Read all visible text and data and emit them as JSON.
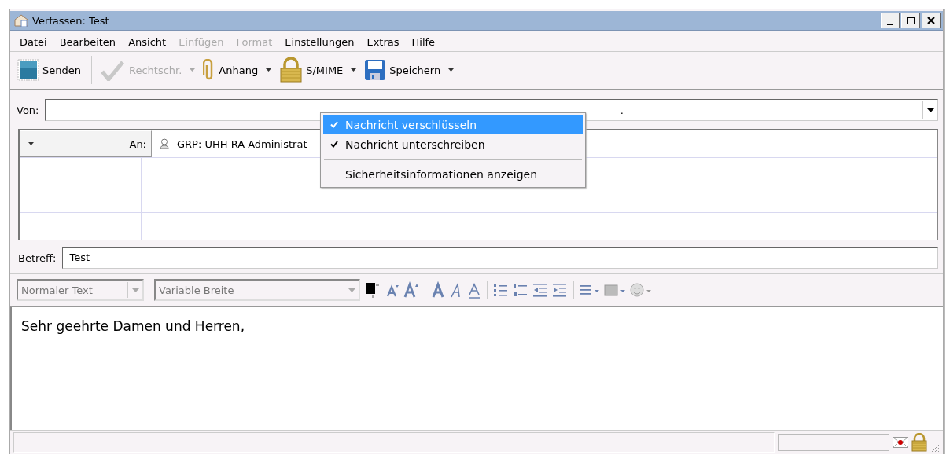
{
  "window": {
    "title": "Verfassen: Test"
  },
  "menu_bar": [
    {
      "label": "Datei",
      "disabled": false
    },
    {
      "label": "Bearbeiten",
      "disabled": false
    },
    {
      "label": "Ansicht",
      "disabled": false
    },
    {
      "label": "Einfügen",
      "disabled": true
    },
    {
      "label": "Format",
      "disabled": true
    },
    {
      "label": "Einstellungen",
      "disabled": false
    },
    {
      "label": "Extras",
      "disabled": false
    },
    {
      "label": "Hilfe",
      "disabled": false
    }
  ],
  "toolbar": [
    {
      "kind": "send",
      "label": "Senden",
      "disabled": false,
      "dropdown": false
    },
    {
      "kind": "spell",
      "label": "Rechtschr.",
      "disabled": true,
      "dropdown": true
    },
    {
      "kind": "attach",
      "label": "Anhang",
      "disabled": false,
      "dropdown": true
    },
    {
      "kind": "lock",
      "label": "S/MIME",
      "disabled": false,
      "dropdown": true
    },
    {
      "kind": "save",
      "label": "Speichern",
      "disabled": false,
      "dropdown": true
    }
  ],
  "smime_menu": [
    {
      "kind": "check",
      "label": "Nachricht verschlüsseln",
      "checked": true,
      "selected": true
    },
    {
      "kind": "check",
      "label": "Nachricht unterschreiben",
      "checked": true,
      "selected": false
    },
    {
      "kind": "separator"
    },
    {
      "kind": "item",
      "label": "Sicherheitsinformationen anzeigen",
      "selected": false
    }
  ],
  "from": {
    "label": "Von:",
    "value": "."
  },
  "recipients": [
    {
      "type": "An:",
      "address": "GRP: UHH RA Administrat"
    }
  ],
  "subject": {
    "label": "Betreff:",
    "value": "Test"
  },
  "format_bar": {
    "paragraph": "Normaler Text",
    "font": "Variable Breite"
  },
  "body": "Sehr geehrte Damen und Herren,"
}
